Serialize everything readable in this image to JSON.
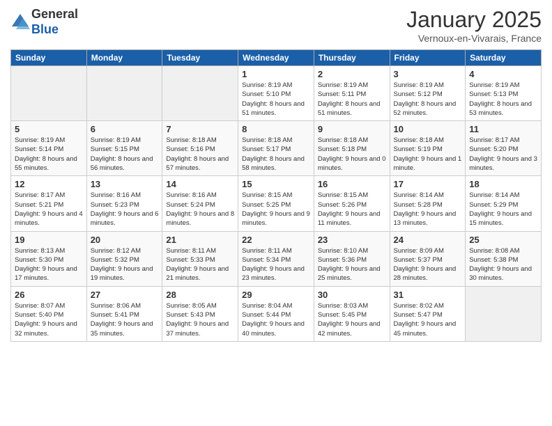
{
  "header": {
    "logo_general": "General",
    "logo_blue": "Blue",
    "month_title": "January 2025",
    "location": "Vernoux-en-Vivarais, France"
  },
  "weekdays": [
    "Sunday",
    "Monday",
    "Tuesday",
    "Wednesday",
    "Thursday",
    "Friday",
    "Saturday"
  ],
  "weeks": [
    [
      {
        "day": "",
        "info": ""
      },
      {
        "day": "",
        "info": ""
      },
      {
        "day": "",
        "info": ""
      },
      {
        "day": "1",
        "info": "Sunrise: 8:19 AM\nSunset: 5:10 PM\nDaylight: 8 hours and 51 minutes."
      },
      {
        "day": "2",
        "info": "Sunrise: 8:19 AM\nSunset: 5:11 PM\nDaylight: 8 hours and 51 minutes."
      },
      {
        "day": "3",
        "info": "Sunrise: 8:19 AM\nSunset: 5:12 PM\nDaylight: 8 hours and 52 minutes."
      },
      {
        "day": "4",
        "info": "Sunrise: 8:19 AM\nSunset: 5:13 PM\nDaylight: 8 hours and 53 minutes."
      }
    ],
    [
      {
        "day": "5",
        "info": "Sunrise: 8:19 AM\nSunset: 5:14 PM\nDaylight: 8 hours and 55 minutes."
      },
      {
        "day": "6",
        "info": "Sunrise: 8:19 AM\nSunset: 5:15 PM\nDaylight: 8 hours and 56 minutes."
      },
      {
        "day": "7",
        "info": "Sunrise: 8:18 AM\nSunset: 5:16 PM\nDaylight: 8 hours and 57 minutes."
      },
      {
        "day": "8",
        "info": "Sunrise: 8:18 AM\nSunset: 5:17 PM\nDaylight: 8 hours and 58 minutes."
      },
      {
        "day": "9",
        "info": "Sunrise: 8:18 AM\nSunset: 5:18 PM\nDaylight: 9 hours and 0 minutes."
      },
      {
        "day": "10",
        "info": "Sunrise: 8:18 AM\nSunset: 5:19 PM\nDaylight: 9 hours and 1 minute."
      },
      {
        "day": "11",
        "info": "Sunrise: 8:17 AM\nSunset: 5:20 PM\nDaylight: 9 hours and 3 minutes."
      }
    ],
    [
      {
        "day": "12",
        "info": "Sunrise: 8:17 AM\nSunset: 5:21 PM\nDaylight: 9 hours and 4 minutes."
      },
      {
        "day": "13",
        "info": "Sunrise: 8:16 AM\nSunset: 5:23 PM\nDaylight: 9 hours and 6 minutes."
      },
      {
        "day": "14",
        "info": "Sunrise: 8:16 AM\nSunset: 5:24 PM\nDaylight: 9 hours and 8 minutes."
      },
      {
        "day": "15",
        "info": "Sunrise: 8:15 AM\nSunset: 5:25 PM\nDaylight: 9 hours and 9 minutes."
      },
      {
        "day": "16",
        "info": "Sunrise: 8:15 AM\nSunset: 5:26 PM\nDaylight: 9 hours and 11 minutes."
      },
      {
        "day": "17",
        "info": "Sunrise: 8:14 AM\nSunset: 5:28 PM\nDaylight: 9 hours and 13 minutes."
      },
      {
        "day": "18",
        "info": "Sunrise: 8:14 AM\nSunset: 5:29 PM\nDaylight: 9 hours and 15 minutes."
      }
    ],
    [
      {
        "day": "19",
        "info": "Sunrise: 8:13 AM\nSunset: 5:30 PM\nDaylight: 9 hours and 17 minutes."
      },
      {
        "day": "20",
        "info": "Sunrise: 8:12 AM\nSunset: 5:32 PM\nDaylight: 9 hours and 19 minutes."
      },
      {
        "day": "21",
        "info": "Sunrise: 8:11 AM\nSunset: 5:33 PM\nDaylight: 9 hours and 21 minutes."
      },
      {
        "day": "22",
        "info": "Sunrise: 8:11 AM\nSunset: 5:34 PM\nDaylight: 9 hours and 23 minutes."
      },
      {
        "day": "23",
        "info": "Sunrise: 8:10 AM\nSunset: 5:36 PM\nDaylight: 9 hours and 25 minutes."
      },
      {
        "day": "24",
        "info": "Sunrise: 8:09 AM\nSunset: 5:37 PM\nDaylight: 9 hours and 28 minutes."
      },
      {
        "day": "25",
        "info": "Sunrise: 8:08 AM\nSunset: 5:38 PM\nDaylight: 9 hours and 30 minutes."
      }
    ],
    [
      {
        "day": "26",
        "info": "Sunrise: 8:07 AM\nSunset: 5:40 PM\nDaylight: 9 hours and 32 minutes."
      },
      {
        "day": "27",
        "info": "Sunrise: 8:06 AM\nSunset: 5:41 PM\nDaylight: 9 hours and 35 minutes."
      },
      {
        "day": "28",
        "info": "Sunrise: 8:05 AM\nSunset: 5:43 PM\nDaylight: 9 hours and 37 minutes."
      },
      {
        "day": "29",
        "info": "Sunrise: 8:04 AM\nSunset: 5:44 PM\nDaylight: 9 hours and 40 minutes."
      },
      {
        "day": "30",
        "info": "Sunrise: 8:03 AM\nSunset: 5:45 PM\nDaylight: 9 hours and 42 minutes."
      },
      {
        "day": "31",
        "info": "Sunrise: 8:02 AM\nSunset: 5:47 PM\nDaylight: 9 hours and 45 minutes."
      },
      {
        "day": "",
        "info": ""
      }
    ]
  ]
}
